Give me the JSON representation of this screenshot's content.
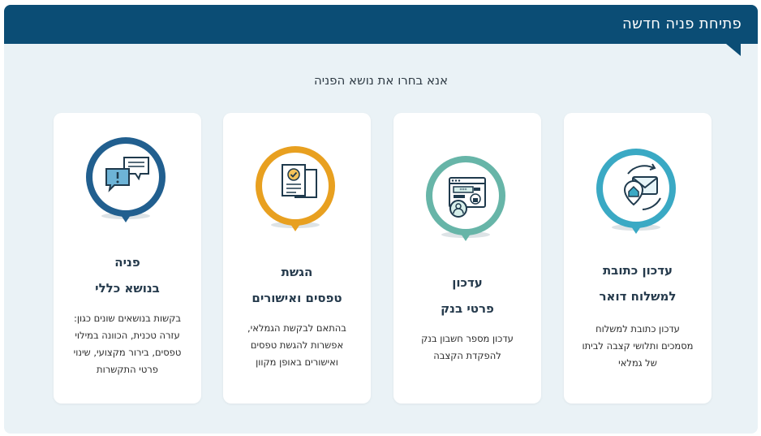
{
  "header": {
    "title": "פתיחת פניה חדשה"
  },
  "subtitle": "אנא בחרו את נושא הפניה",
  "cards": [
    {
      "icon": "mail-address-icon",
      "color": "#3aa9c4",
      "title_line1": "עדכון כתובת",
      "title_line2": "למשלוח דואר",
      "desc_line1": "עדכון כתובת למשלוח",
      "desc_line2": "מסמכים ותלושי קצבה לביתו",
      "desc_line3": "של גמלאי"
    },
    {
      "icon": "bank-form-icon",
      "color": "#67b5a8",
      "title_line1": "עדכון",
      "title_line2": "פרטי בנק",
      "desc_line1": "עדכון מספר חשבון בנק",
      "desc_line2": "להפקדת הקצבה"
    },
    {
      "icon": "documents-check-icon",
      "color": "#e8a020",
      "title_line1": "הגשת",
      "title_line2": "טפסים ואישורים",
      "desc_line1": "בהתאם לבקשת הגמלאי,",
      "desc_line2": "אפשרות להגשת טפסים",
      "desc_line3": "ואישורים באופן מקוון"
    },
    {
      "icon": "chat-bubbles-icon",
      "color": "#215f8f",
      "title_line1": "פניה",
      "title_line2": "בנושא כללי",
      "desc_line1": "בקשות בנושאים שונים כגון:",
      "desc_line2": "עזרה טכנית, הכוונה במילוי",
      "desc_line3": "טפסים, בירור מקצועי, שינוי",
      "desc_line4": "פרטי התקשרות"
    }
  ]
}
